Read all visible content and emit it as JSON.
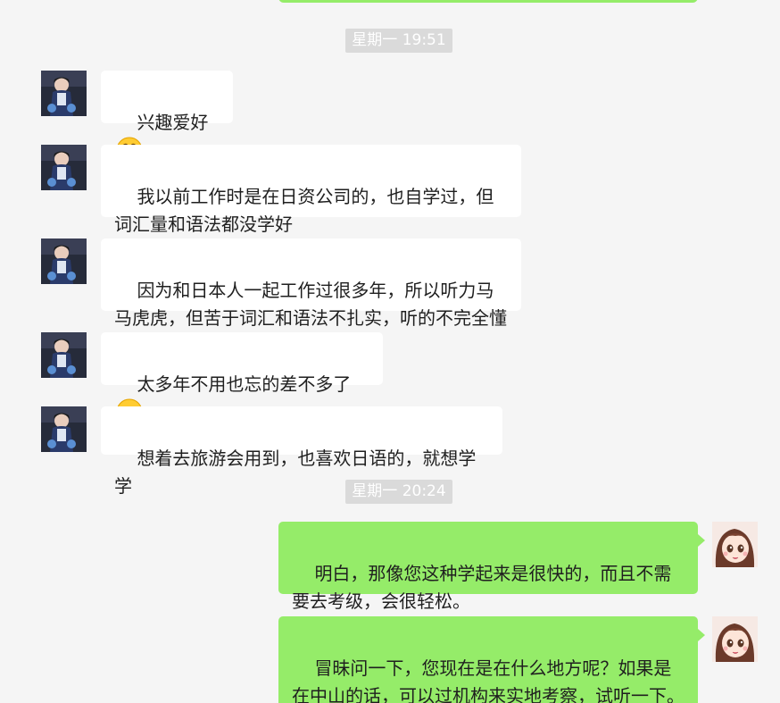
{
  "timestamps": [
    "星期一 19:51",
    "星期一 20:24"
  ],
  "messages": [
    {
      "text": "兴趣爱好",
      "emoji": "grinning-face-emoji"
    },
    {
      "text": "我以前工作时是在日资公司的，也自学过，但词汇量和语法都没学好"
    },
    {
      "text": "因为和日本人一起工作过很多年，所以听力马马虎虎，但苦于词汇和语法不扎实，听的不完全懂"
    },
    {
      "text": "太多年不用也忘的差不多了",
      "emoji": "crying-face-emoji"
    },
    {
      "text": "想着去旅游会用到，也喜欢日语的，就想学学"
    },
    {
      "text": "明白，那像您这种学起来是很快的，而且不需要去考级，会很轻松。"
    },
    {
      "text": "冒昧问一下，您现在是在什么地方呢？如果是在中山的话，可以过机构来实地考察，试听一下。如果不在中山的话，可以进行一个线上的试听"
    }
  ],
  "colors": {
    "background": "#f5f5f5",
    "incoming_bubble": "#ffffff",
    "outgoing_bubble": "#95ec69",
    "timestamp_bg": "#dadada"
  }
}
